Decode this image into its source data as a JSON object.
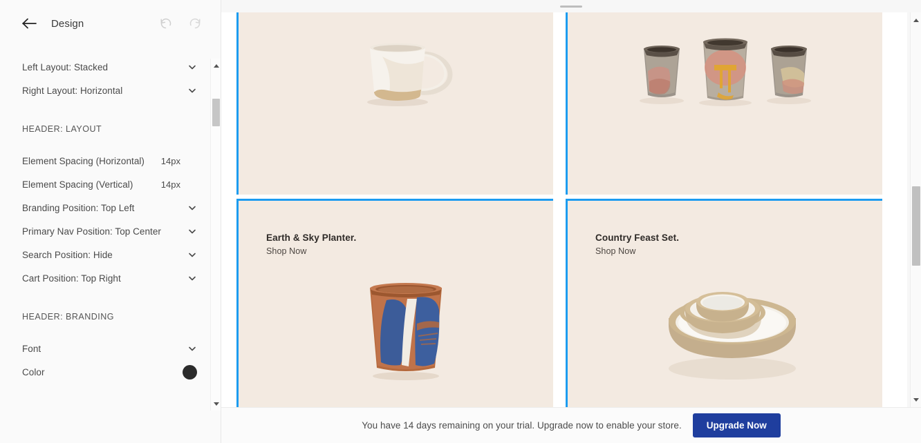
{
  "sidebar": {
    "title": "Design",
    "back_icon": "back-arrow-icon",
    "undo_icon": "undo-icon",
    "redo_icon": "redo-icon",
    "top_rows": [
      {
        "label": "Left Layout: Stacked",
        "control": "chevron"
      },
      {
        "label": "Right Layout: Horizontal",
        "control": "chevron"
      }
    ],
    "sections": [
      {
        "heading": "HEADER: LAYOUT",
        "rows": [
          {
            "label": "Element Spacing (Horizontal)",
            "value": "14px",
            "control": "value"
          },
          {
            "label": "Element Spacing (Vertical)",
            "value": "14px",
            "control": "value"
          },
          {
            "label": "Branding Position: Top Left",
            "control": "chevron"
          },
          {
            "label": "Primary Nav Position: Top Center",
            "control": "chevron"
          },
          {
            "label": "Search Position: Hide",
            "control": "chevron"
          },
          {
            "label": "Cart Position: Top Right",
            "control": "chevron"
          }
        ]
      },
      {
        "heading": "HEADER: BRANDING",
        "rows": [
          {
            "label": "Font",
            "control": "chevron"
          },
          {
            "label": "Color",
            "control": "swatch",
            "value": "#2b2b2b"
          }
        ]
      }
    ]
  },
  "canvas": {
    "selection_color": "#1c9cf0",
    "cell_background": "#f3eae1",
    "cells": [
      {
        "name": "mug-tile",
        "title": "",
        "link": "",
        "product": "white-mug"
      },
      {
        "name": "cups-tile",
        "title": "",
        "link": "",
        "product": "three-cups"
      },
      {
        "name": "planter-tile",
        "title": "Earth & Sky Planter.",
        "link": "Shop Now",
        "product": "blue-planter"
      },
      {
        "name": "feast-set-tile",
        "title": "Country Feast Set.",
        "link": "Shop Now",
        "product": "nested-bowls"
      }
    ]
  },
  "footer": {
    "message": "You have 14 days remaining on your trial. Upgrade now to enable your store.",
    "button_label": "Upgrade Now",
    "button_color": "#1f3e9e"
  }
}
